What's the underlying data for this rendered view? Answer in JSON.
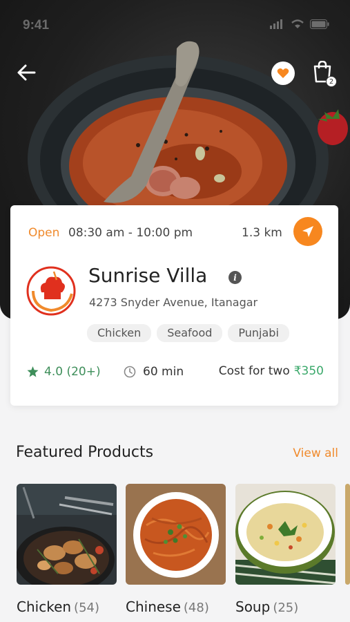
{
  "status_bar": {
    "time": "9:41"
  },
  "header": {
    "back_icon": "arrow-left-icon",
    "favorite_icon": "heart-icon",
    "cart_icon": "shopping-bag-icon",
    "cart_count": "2"
  },
  "restaurant": {
    "open_label": "Open",
    "hours": "08:30 am - 10:00 pm",
    "distance": "1.3 km",
    "name": "Sunrise Villa",
    "address": "4273 Snyder Avenue, Itanagar",
    "tags": [
      "Chicken",
      "Seafood",
      "Punjabi"
    ],
    "rating": "4.0 (20+)",
    "delivery_time": "60 min",
    "cost_label": "Cost for two",
    "cost_value": "₹350"
  },
  "featured": {
    "title": "Featured Products",
    "view_all": "View all",
    "items": [
      {
        "name": "Chicken",
        "count": "(54)"
      },
      {
        "name": "Chinese",
        "count": "(48)"
      },
      {
        "name": "Soup",
        "count": "(25)"
      }
    ]
  },
  "colors": {
    "accent": "#f7871f",
    "rating_green": "#3e8e5a",
    "price_green": "#3aa86a"
  }
}
